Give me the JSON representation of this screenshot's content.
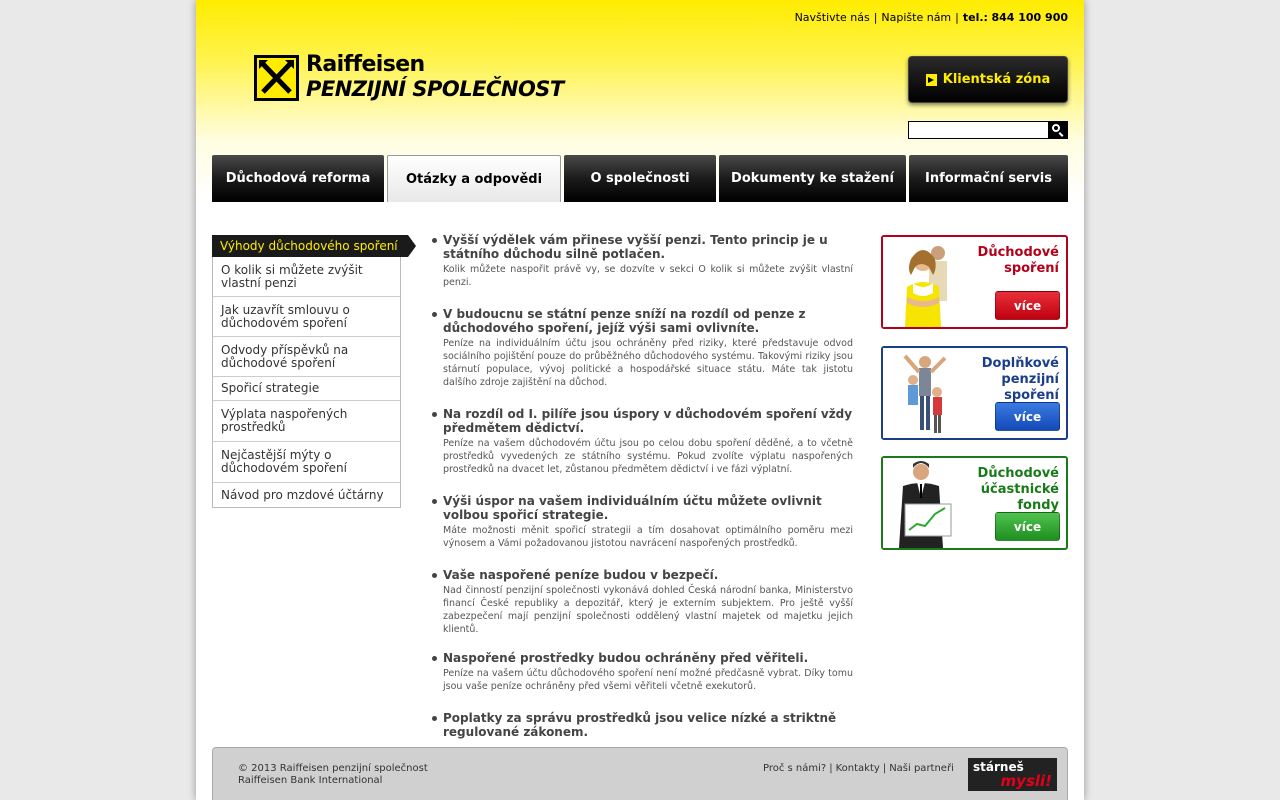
{
  "header": {
    "links": [
      "Navštivte nás",
      "Napište nám"
    ],
    "phone_prefix": "tel.:",
    "phone": "844 100 900",
    "logo_name": "Raiffeisen",
    "logo_sub": "PENZIJNÍ SPOLEČNOST",
    "client_zone_label": "Klientská zóna",
    "search_value": ""
  },
  "nav": {
    "tabs": [
      {
        "label": "Důchodová reforma",
        "active": false
      },
      {
        "label": "Otázky a odpovědi",
        "active": true
      },
      {
        "label": "O společnosti",
        "active": false
      },
      {
        "label": "Dokumenty ke stažení",
        "active": false
      },
      {
        "label": "Informační servis",
        "active": false
      }
    ]
  },
  "sidebar": {
    "title": "Výhody důchodového spoření",
    "items": [
      "O kolik si můžete zvýšit vlastní penzi",
      "Jak uzavřít smlouvu o důchodovém spoření",
      "Odvody příspěvků na důchodové spoření",
      "Spořicí strategie",
      "Výplata naspořených prostředků",
      "Nejčastější mýty o důchodovém spoření",
      "Návod pro mzdové účtárny"
    ]
  },
  "main": {
    "items": [
      {
        "title": "Vyšší výdělek vám přinese vyšší penzi. Tento princip je u státního důchodu silně potlačen.",
        "text": "Kolik můžete naspořit právě vy, se dozvíte v sekci O kolik si můžete zvýšit vlastní penzi."
      },
      {
        "title": "V budoucnu se státní penze sníží na rozdíl od penze z důchodového spoření, jejíž výši sami ovlivníte.",
        "text": "Peníze na individuálním účtu jsou ochráněny před riziky, které představuje odvod sociálního pojištění pouze do průběžného důchodového systému. Takovými riziky jsou stárnutí populace, vývoj politické a hospodářské situace státu. Máte tak jistotu dalšího zdroje zajištění na důchod."
      },
      {
        "title": "Na rozdíl od I. pilíře jsou úspory v důchodovém spoření vždy předmětem dědictví.",
        "text": "Peníze na vašem důchodovém účtu jsou po celou dobu spoření děděné, a to včetně prostředků vyvedených ze státního systému. Pokud zvolíte výplatu naspořených prostředků na dvacet let, zůstanou předmětem dědictví i ve fázi výplatní."
      },
      {
        "title": "Výši úspor na vašem individuálním účtu můžete ovlivnit volbou spořicí strategie.",
        "text": "Máte možnosti měnit spořicí strategii a tím dosahovat optimálního poměru mezi výnosem a Vámi požadovanou jistotou navrácení naspořených prostředků."
      },
      {
        "title": "Vaše naspořené peníze budou v bezpečí.",
        "text": "Nad činností penzijní společnosti vykonává dohled Česká národní banka, Ministerstvo financí České republiky a depozitář, který je externím subjektem. Pro ještě vyšší zabezpečení mají penzijní společnosti oddělený vlastní majetek od majetku jejich klientů."
      },
      {
        "title": "Naspořené prostředky budou ochráněny před věřiteli.",
        "text": "Peníze na vašem účtu důchodového spoření není možné předčasně vybrat. Díky tomu jsou vaše peníze ochráněny před všemi věřiteli včetně exekutorů."
      },
      {
        "title": "Poplatky za správu prostředků jsou velice nízké a striktně regulované zákonem.",
        "text": ""
      }
    ]
  },
  "promos": [
    {
      "title": "Důchodové spoření",
      "button": "více",
      "color": "#b3001b",
      "button_color": "#d10f1f"
    },
    {
      "title": "Doplňkové penzijní spoření",
      "button": "více",
      "color": "#1a3e8c",
      "button_color": "#1d55c8"
    },
    {
      "title": "Důchodové účastnické fondy",
      "button": "více",
      "color": "#1a7a1a",
      "button_color": "#2fa82f"
    }
  ],
  "footer": {
    "copyright": "© 2013 Raiffeisen penzijní společnost",
    "company": "Raiffeisen Bank International",
    "links": [
      "Proč s námi?",
      "Kontakty",
      "Naši partneři"
    ],
    "badge_line1": "stárneš",
    "badge_line2": "mysli!"
  }
}
